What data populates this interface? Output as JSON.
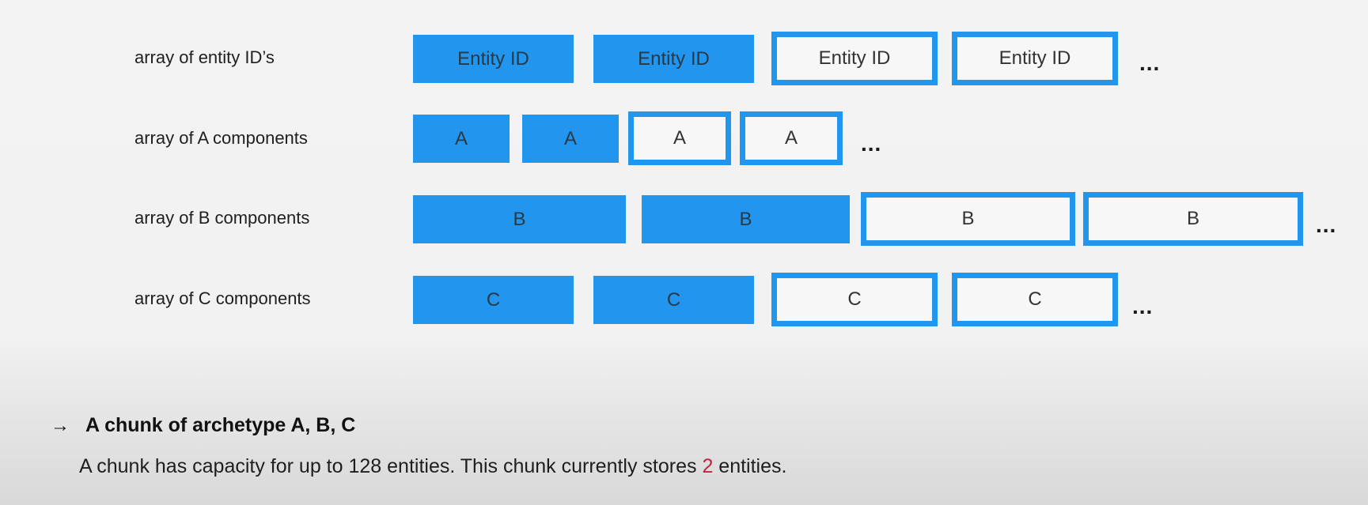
{
  "rows": [
    {
      "label": "array of entity ID’s",
      "cells": [
        "Entity ID",
        "Entity ID",
        "Entity ID",
        "Entity ID"
      ],
      "filled": [
        true,
        true,
        false,
        false
      ],
      "ellipsis": "..."
    },
    {
      "label": "array of A components",
      "cells": [
        "A",
        "A",
        "A",
        "A"
      ],
      "filled": [
        true,
        true,
        false,
        false
      ],
      "ellipsis": "..."
    },
    {
      "label": "array of B components",
      "cells": [
        "B",
        "B",
        "B",
        "B"
      ],
      "filled": [
        true,
        true,
        false,
        false
      ],
      "ellipsis": "..."
    },
    {
      "label": "array of C components",
      "cells": [
        "C",
        "C",
        "C",
        "C"
      ],
      "filled": [
        true,
        true,
        false,
        false
      ],
      "ellipsis": "..."
    }
  ],
  "footer": {
    "arrow": "→",
    "heading": "A chunk of archetype A, B, C",
    "desc_before": "A chunk has capacity for up to 128 entities. This chunk currently stores ",
    "desc_count": "2",
    "desc_after": " entities."
  },
  "colors": {
    "accent": "#2295ee",
    "highlight": "#c0243a"
  }
}
